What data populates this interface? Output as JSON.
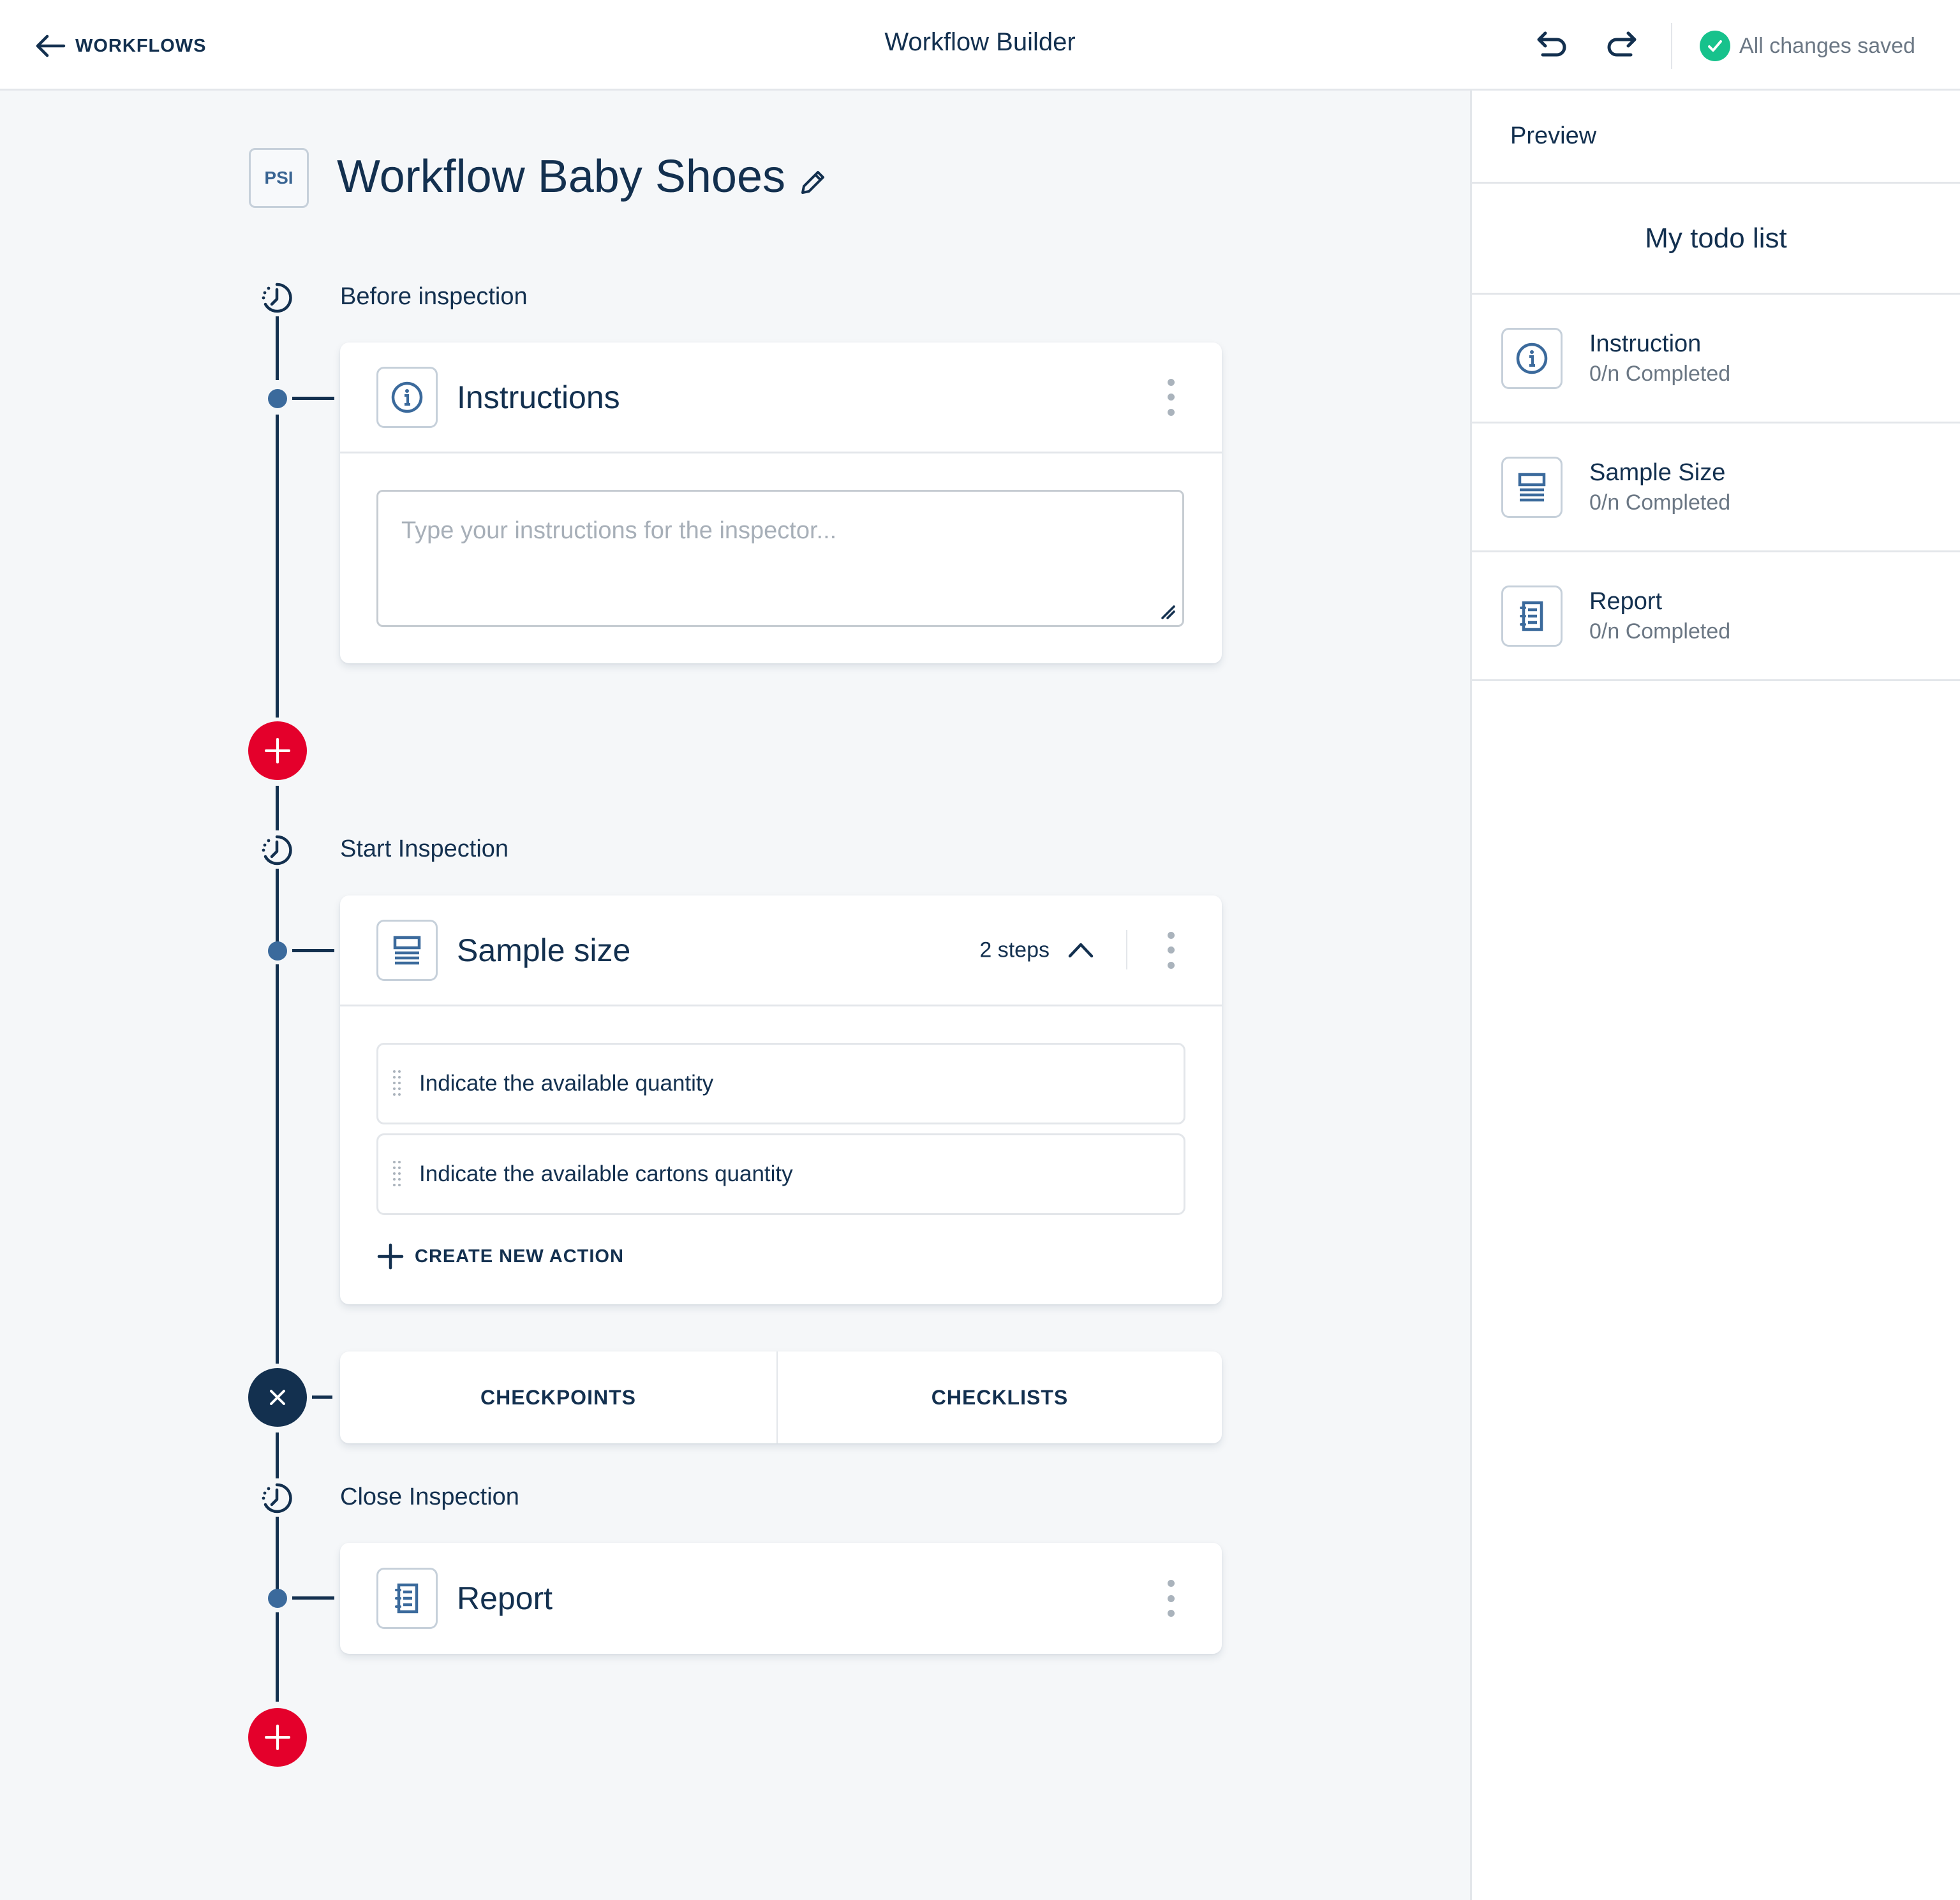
{
  "header": {
    "back_label": "WORKFLOWS",
    "title": "Workflow Builder",
    "save_status": "All changes saved"
  },
  "workflow": {
    "badge": "PSI",
    "title": "Workflow Baby Shoes"
  },
  "stages": [
    {
      "label": "Before inspection",
      "cards": [
        {
          "title": "Instructions",
          "icon": "info-icon",
          "textarea_placeholder": "Type your instructions for the inspector...",
          "textarea_value": ""
        }
      ]
    },
    {
      "label": "Start Inspection",
      "cards": [
        {
          "title": "Sample size",
          "icon": "sample-size-icon",
          "steps_count": "2 steps",
          "expanded": true,
          "actions": [
            "Indicate the available quantity",
            "Indicate the available cartons quantity"
          ],
          "create_action_label": "CREATE NEW ACTION"
        }
      ],
      "add_menu": {
        "open": true,
        "options": [
          "CHECKPOINTS",
          "CHECKLISTS"
        ]
      }
    },
    {
      "label": "Close Inspection",
      "cards": [
        {
          "title": "Report",
          "icon": "report-icon"
        }
      ]
    }
  ],
  "preview": {
    "header": "Preview",
    "todo_title": "My todo list",
    "items": [
      {
        "name": "Instruction",
        "status": "0/n Completed",
        "icon": "info-icon"
      },
      {
        "name": "Sample Size",
        "status": "0/n Completed",
        "icon": "sample-size-icon"
      },
      {
        "name": "Report",
        "status": "0/n Completed",
        "icon": "report-icon"
      }
    ]
  },
  "colors": {
    "primary": "#13304f",
    "accent_blue": "#3b6a9c",
    "add_red": "#e4002b",
    "success_green": "#17c28c",
    "background": "#f5f7f9"
  }
}
